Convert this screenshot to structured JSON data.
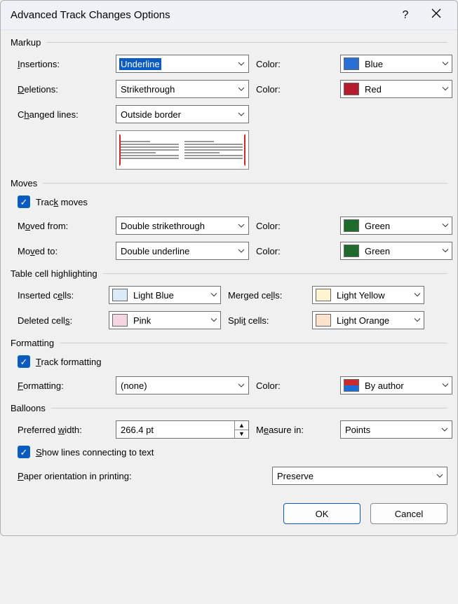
{
  "title": "Advanced Track Changes Options",
  "groups": {
    "markup": {
      "title": "Markup",
      "insertions": {
        "label": "Insertions:",
        "value": "Underline",
        "color_label": "Color:",
        "color_name": "Blue",
        "color_hex": "#2a6fd6"
      },
      "deletions": {
        "label": "Deletions:",
        "value": "Strikethrough",
        "color_label": "Color:",
        "color_name": "Red",
        "color_hex": "#b61c2e"
      },
      "changed_lines": {
        "label": "Changed lines:",
        "value": "Outside border"
      }
    },
    "moves": {
      "title": "Moves",
      "track_moves": {
        "label": "Track moves",
        "checked": true
      },
      "moved_from": {
        "label": "Moved from:",
        "value": "Double strikethrough",
        "color_label": "Color:",
        "color_name": "Green",
        "color_hex": "#1f6b2b"
      },
      "moved_to": {
        "label": "Moved to:",
        "value": "Double underline",
        "color_label": "Color:",
        "color_name": "Green",
        "color_hex": "#1f6b2b"
      }
    },
    "table_cells": {
      "title": "Table cell highlighting",
      "inserted": {
        "label": "Inserted cells:",
        "color_name": "Light Blue",
        "color_hex": "#dbeaf7"
      },
      "deleted": {
        "label": "Deleted cells:",
        "color_name": "Pink",
        "color_hex": "#f6d5e2"
      },
      "merged": {
        "label": "Merged cells:",
        "color_name": "Light Yellow",
        "color_hex": "#fef4d2"
      },
      "split": {
        "label": "Split cells:",
        "color_name": "Light Orange",
        "color_hex": "#fbe2cc"
      }
    },
    "formatting": {
      "title": "Formatting",
      "track_formatting": {
        "label": "Track formatting",
        "checked": true
      },
      "formatting": {
        "label": "Formatting:",
        "value": "(none)",
        "color_label": "Color:",
        "color_name": "By author"
      }
    },
    "balloons": {
      "title": "Balloons",
      "preferred_width": {
        "label": "Preferred width:",
        "value": "266.4 pt"
      },
      "measure_in": {
        "label": "Measure in:",
        "value": "Points"
      },
      "show_lines": {
        "label": "Show lines connecting to text",
        "checked": true
      },
      "paper_orientation": {
        "label": "Paper orientation in printing:",
        "value": "Preserve"
      }
    }
  },
  "footer": {
    "ok": "OK",
    "cancel": "Cancel"
  }
}
